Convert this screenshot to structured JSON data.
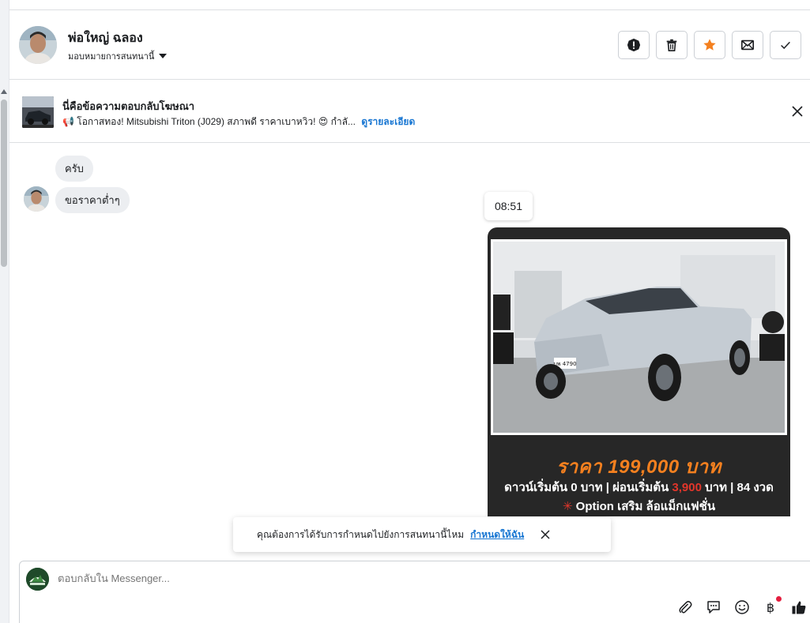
{
  "header": {
    "name": "พ่อใหญ่ ฉลอง",
    "assign_label": "มอบหมายการสนทนานี้",
    "actions": [
      "mark-spam",
      "delete",
      "star",
      "mark-unread",
      "mark-done"
    ]
  },
  "ad": {
    "title": "นี่คือข้อความตอบกลับโฆษณา",
    "description": "📢 โอกาสทอง! Mitsubishi Triton (J029) สภาพดี ราคาเบาหวิว! 😍 กำลั...",
    "details_link": "ดูรายละเอียด"
  },
  "messages": [
    {
      "text": "ครับ"
    },
    {
      "text": "ขอราคาต่ำๆ"
    }
  ],
  "timestamp": "08:51",
  "card": {
    "price": "ราคา 199,000 บาท",
    "terms_prefix": "ดาวน์เริ่มต้น 0 บาท | ผ่อนเริ่มต้น ",
    "terms_amount": "3,900",
    "terms_suffix": " บาท | 84 งวด",
    "option_star": "✳",
    "option": " Option เสริม ล้อแม็กแฟชั่น",
    "plate_text": "บพ 4790"
  },
  "toast": {
    "text": "คุณต้องการได้รับการกำหนดไปยังการสนทนานี้ไหม",
    "link": "กำหนดให้ฉัน"
  },
  "composer": {
    "placeholder": "ตอบกลับใน Messenger..."
  },
  "colors": {
    "accent_blue": "#1876d2",
    "star_orange": "#f4801f",
    "price_orange": "#f4801f",
    "highlight_red": "#e2362b"
  }
}
